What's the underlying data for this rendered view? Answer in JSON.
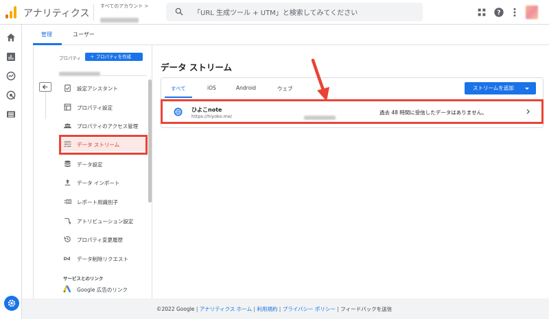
{
  "app": {
    "title": "アナリティクス"
  },
  "header": {
    "account_label": "すべてのアカウント >",
    "search_placeholder": "「URL 生成ツール + UTM」と検索してみてください",
    "colors": {
      "brand_orange": "#f9ab00",
      "brand_dark": "#e37400"
    }
  },
  "admin_tabs": [
    {
      "label": "管理"
    },
    {
      "label": "ユーザー"
    }
  ],
  "property": {
    "label": "プロパティ",
    "create_button": "＋ プロパティを作成"
  },
  "menu": [
    {
      "label": "設定アシスタント",
      "icon": "clipboard-check-icon"
    },
    {
      "label": "プロパティ設定",
      "icon": "document-icon"
    },
    {
      "label": "プロパティのアクセス管理",
      "icon": "people-icon"
    },
    {
      "label": "データ ストリーム",
      "icon": "stream-icon"
    },
    {
      "label": "データ設定",
      "icon": "database-icon"
    },
    {
      "label": "データ インポート",
      "icon": "upload-icon"
    },
    {
      "label": "レポート用識別子",
      "icon": "identifier-icon"
    },
    {
      "label": "アトリビューション設定",
      "icon": "attribution-icon"
    },
    {
      "label": "プロパティ変更履歴",
      "icon": "history-icon"
    },
    {
      "label": "データ削除リクエスト",
      "icon": "dd-icon"
    }
  ],
  "links_section": {
    "header": "サービスとのリンク",
    "items": [
      {
        "label": "Google 広告のリンク",
        "icon": "google-ads-icon"
      }
    ]
  },
  "main": {
    "title": "データ ストリーム",
    "filter_tabs": [
      {
        "label": "すべて"
      },
      {
        "label": "iOS"
      },
      {
        "label": "Android"
      },
      {
        "label": "ウェブ"
      }
    ],
    "add_stream_button": "ストリームを追加",
    "stream": {
      "name": "ひよこnote",
      "url": "https://hiyoko.me/",
      "status": "過去 48 時間に受信したデータはありません。"
    }
  },
  "footer": {
    "copyright": "©2022 Google",
    "links": [
      {
        "label": "アナリティクス ホーム"
      },
      {
        "label": "利用規約"
      },
      {
        "label": "プライバシー ポリシー"
      }
    ],
    "feedback": "フィードバックを送信"
  },
  "colors": {
    "accent": "#1a73e8",
    "highlight": "#ea4335"
  }
}
